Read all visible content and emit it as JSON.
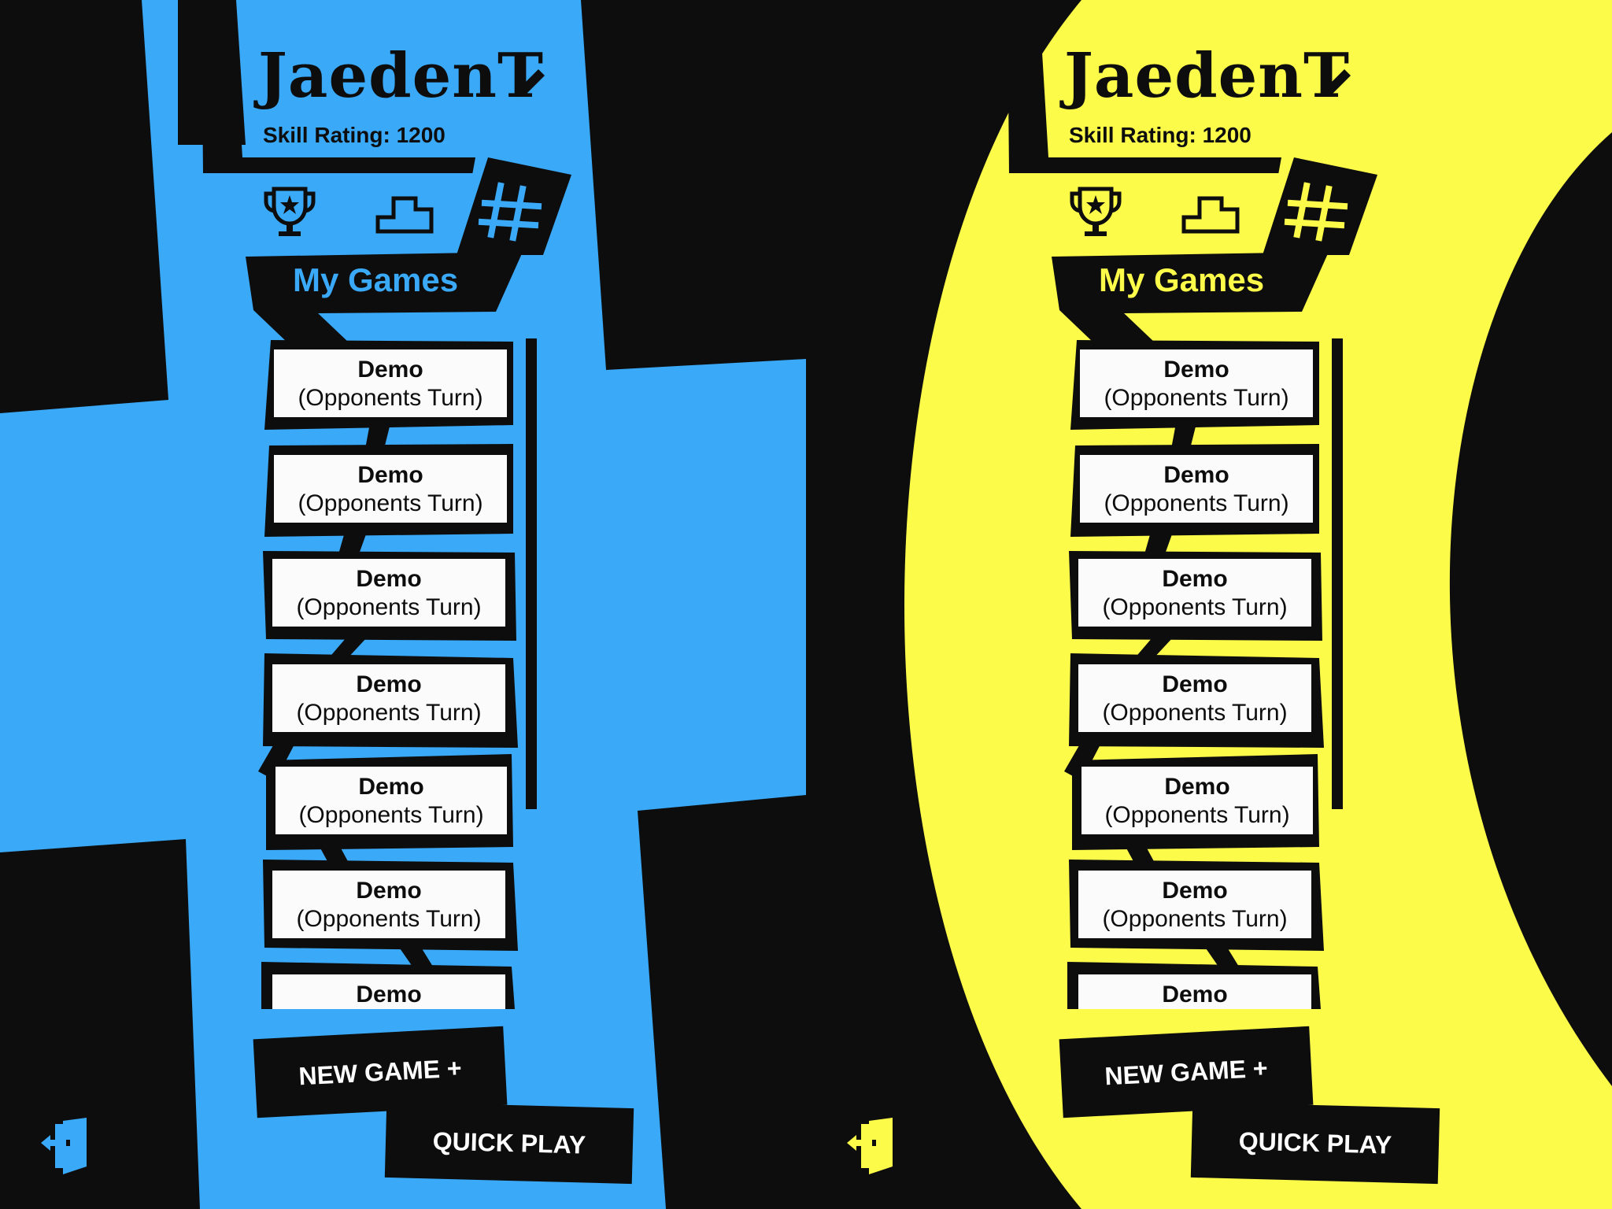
{
  "theme": {
    "black": "#0d0d0d",
    "white": "#fbfbfb",
    "left_accent": "#3aa9f8",
    "right_accent": "#fcfb4a"
  },
  "panels": [
    {
      "variant": "blue",
      "accent": "#3aa9f8",
      "profile": {
        "username": "JaedenT",
        "skill_rating": "Skill Rating: 1200"
      },
      "nav": {
        "trophy_icon": "trophy-icon",
        "podium_icon": "podium-icon",
        "games_icon": "hash-grid-icon",
        "active_tab": "My Games"
      },
      "games": [
        {
          "name": "Demo",
          "status": "(Opponents Turn)"
        },
        {
          "name": "Demo",
          "status": "(Opponents Turn)"
        },
        {
          "name": "Demo",
          "status": "(Opponents Turn)"
        },
        {
          "name": "Demo",
          "status": "(Opponents Turn)"
        },
        {
          "name": "Demo",
          "status": "(Opponents Turn)"
        },
        {
          "name": "Demo",
          "status": "(Opponents Turn)"
        },
        {
          "name": "Demo",
          "status": ""
        }
      ],
      "buttons": {
        "new_game": "NEW GAME +",
        "quick_play": "QUICK PLAY"
      }
    },
    {
      "variant": "yellow",
      "accent": "#fcfb4a",
      "profile": {
        "username": "JaedenT",
        "skill_rating": "Skill Rating: 1200"
      },
      "nav": {
        "trophy_icon": "trophy-icon",
        "podium_icon": "podium-icon",
        "games_icon": "hash-grid-icon",
        "active_tab": "My Games"
      },
      "games": [
        {
          "name": "Demo",
          "status": "(Opponents Turn)"
        },
        {
          "name": "Demo",
          "status": "(Opponents Turn)"
        },
        {
          "name": "Demo",
          "status": "(Opponents Turn)"
        },
        {
          "name": "Demo",
          "status": "(Opponents Turn)"
        },
        {
          "name": "Demo",
          "status": "(Opponents Turn)"
        },
        {
          "name": "Demo",
          "status": "(Opponents Turn)"
        },
        {
          "name": "Demo",
          "status": ""
        }
      ],
      "buttons": {
        "new_game": "NEW GAME +",
        "quick_play": "QUICK PLAY"
      }
    }
  ]
}
